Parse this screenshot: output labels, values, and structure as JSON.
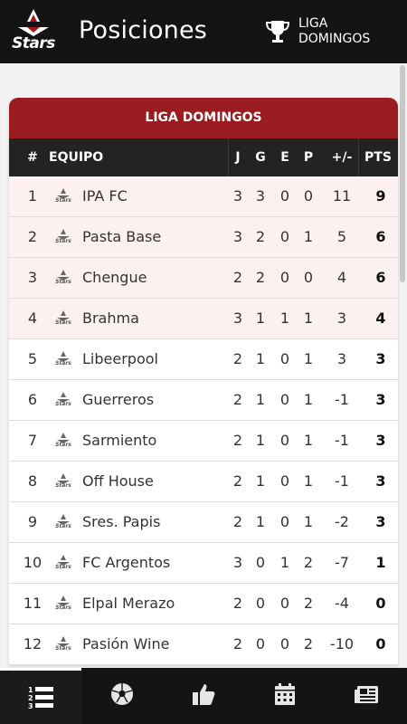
{
  "header": {
    "logo_text": "Stars",
    "title": "Posiciones",
    "league_label": "LIGA DOMINGOS"
  },
  "table": {
    "title": "LIGA DOMINGOS",
    "columns": {
      "num": "#",
      "team": "EQUIPO",
      "j": "J",
      "g": "G",
      "e": "E",
      "p": "P",
      "dif": "+/-",
      "pts": "PTS"
    },
    "rows": [
      {
        "pos": "1",
        "team": "IPA FC",
        "j": "3",
        "g": "3",
        "e": "0",
        "p": "0",
        "dif": "11",
        "pts": "9",
        "highlight": true
      },
      {
        "pos": "2",
        "team": "Pasta Base",
        "j": "3",
        "g": "2",
        "e": "0",
        "p": "1",
        "dif": "5",
        "pts": "6",
        "highlight": true
      },
      {
        "pos": "3",
        "team": "Chengue",
        "j": "2",
        "g": "2",
        "e": "0",
        "p": "0",
        "dif": "4",
        "pts": "6",
        "highlight": true
      },
      {
        "pos": "4",
        "team": "Brahma",
        "j": "3",
        "g": "1",
        "e": "1",
        "p": "1",
        "dif": "3",
        "pts": "4",
        "highlight": true
      },
      {
        "pos": "5",
        "team": "Libeerpool",
        "j": "2",
        "g": "1",
        "e": "0",
        "p": "1",
        "dif": "3",
        "pts": "3",
        "highlight": false
      },
      {
        "pos": "6",
        "team": "Guerreros",
        "j": "2",
        "g": "1",
        "e": "0",
        "p": "1",
        "dif": "-1",
        "pts": "3",
        "highlight": false
      },
      {
        "pos": "7",
        "team": "Sarmiento",
        "j": "2",
        "g": "1",
        "e": "0",
        "p": "1",
        "dif": "-1",
        "pts": "3",
        "highlight": false
      },
      {
        "pos": "8",
        "team": "Off House",
        "j": "2",
        "g": "1",
        "e": "0",
        "p": "1",
        "dif": "-1",
        "pts": "3",
        "highlight": false
      },
      {
        "pos": "9",
        "team": "Sres. Papis",
        "j": "2",
        "g": "1",
        "e": "0",
        "p": "1",
        "dif": "-2",
        "pts": "3",
        "highlight": false
      },
      {
        "pos": "10",
        "team": "FC Argentos",
        "j": "3",
        "g": "0",
        "e": "1",
        "p": "2",
        "dif": "-7",
        "pts": "1",
        "highlight": false
      },
      {
        "pos": "11",
        "team": "Elpal Merazo",
        "j": "2",
        "g": "0",
        "e": "0",
        "p": "2",
        "dif": "-4",
        "pts": "0",
        "highlight": false
      },
      {
        "pos": "12",
        "team": "Pasión Wine",
        "j": "2",
        "g": "0",
        "e": "0",
        "p": "2",
        "dif": "-10",
        "pts": "0",
        "highlight": false
      }
    ]
  },
  "nav": {
    "items": [
      {
        "icon": "standings-list-icon",
        "active": true
      },
      {
        "icon": "soccer-ball-icon",
        "active": false
      },
      {
        "icon": "thumbs-up-icon",
        "active": false
      },
      {
        "icon": "calendar-icon",
        "active": false
      },
      {
        "icon": "newspaper-icon",
        "active": false
      }
    ]
  },
  "colors": {
    "topbar": "#141414",
    "table_header": "#9b1c20",
    "column_header": "#232323",
    "highlight_row": "#fdf0f0"
  }
}
